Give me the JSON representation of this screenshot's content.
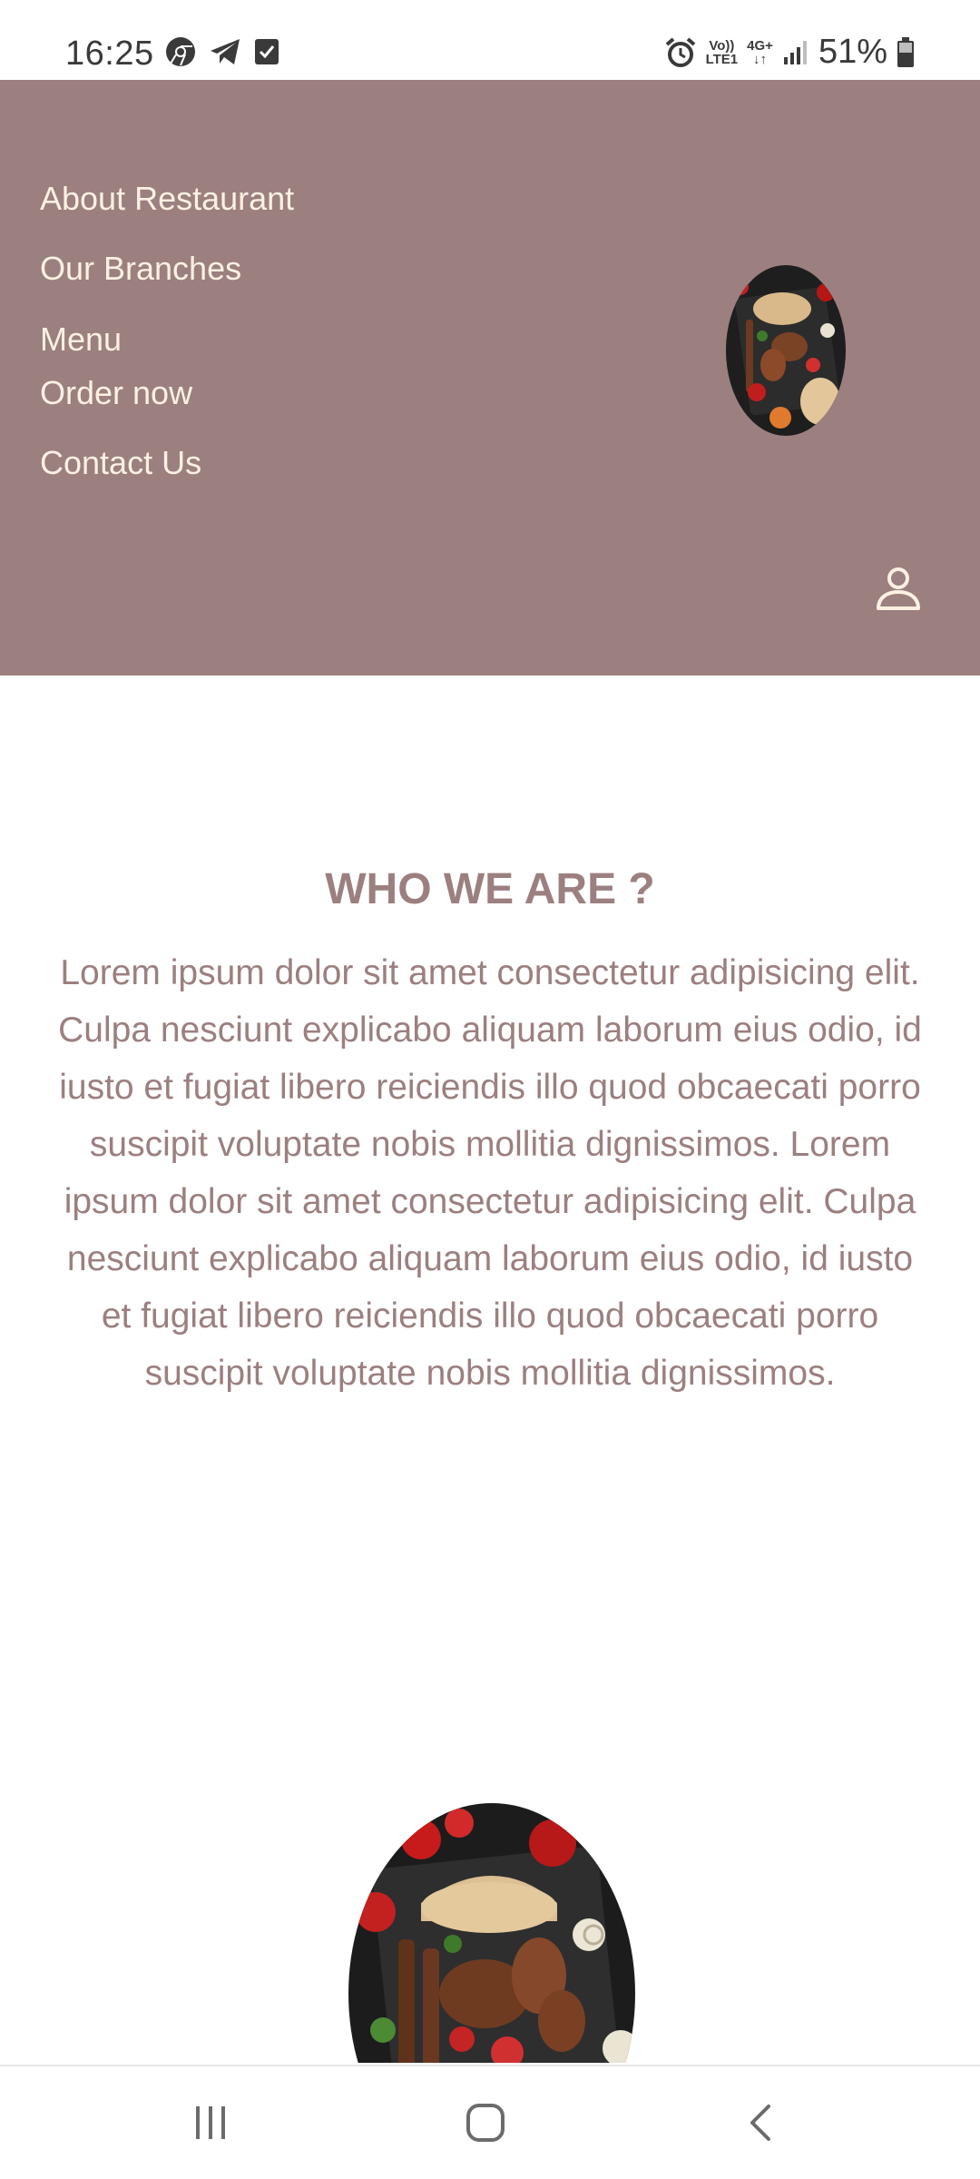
{
  "status_bar": {
    "time": "16:25",
    "left_icons": [
      "chrome-icon",
      "telegram-icon",
      "checkbox-icon"
    ],
    "right_icons": [
      "alarm-icon",
      "volte-icon",
      "4g-icon",
      "signal-icon"
    ],
    "volte_top": "Vo))",
    "volte_bottom": "LTE1",
    "net_top": "4G+",
    "net_bottom": "↓↑",
    "battery_percent": "51%"
  },
  "header": {
    "background": "#9c7f7f",
    "text_color": "#fbf1e2",
    "nav_items": [
      {
        "label": "About Restaurant"
      },
      {
        "label": "Our Branches"
      },
      {
        "label": "Menu"
      },
      {
        "label": "Order now"
      },
      {
        "label": "Contact Us"
      }
    ],
    "user_icon": "user-icon"
  },
  "about": {
    "title": "WHO WE ARE ?",
    "body": "Lorem ipsum dolor sit amet consectetur adipisicing elit. Culpa nesciunt explicabo aliquam laborum eius odio, id iusto et fugiat libero reiciendis illo quod obcaecati porro suscipit voluptate nobis mollitia dignissimos. Lorem ipsum dolor sit amet consectetur adipisicing elit. Culpa nesciunt explicabo aliquam laborum eius odio, id iusto et fugiat libero reiciendis illo quod obcaecati porro suscipit voluptate nobis mollitia dignissimos.",
    "text_color": "#9c7f7f"
  },
  "system_nav": {
    "buttons": [
      "recents-icon",
      "home-icon",
      "back-icon"
    ]
  }
}
